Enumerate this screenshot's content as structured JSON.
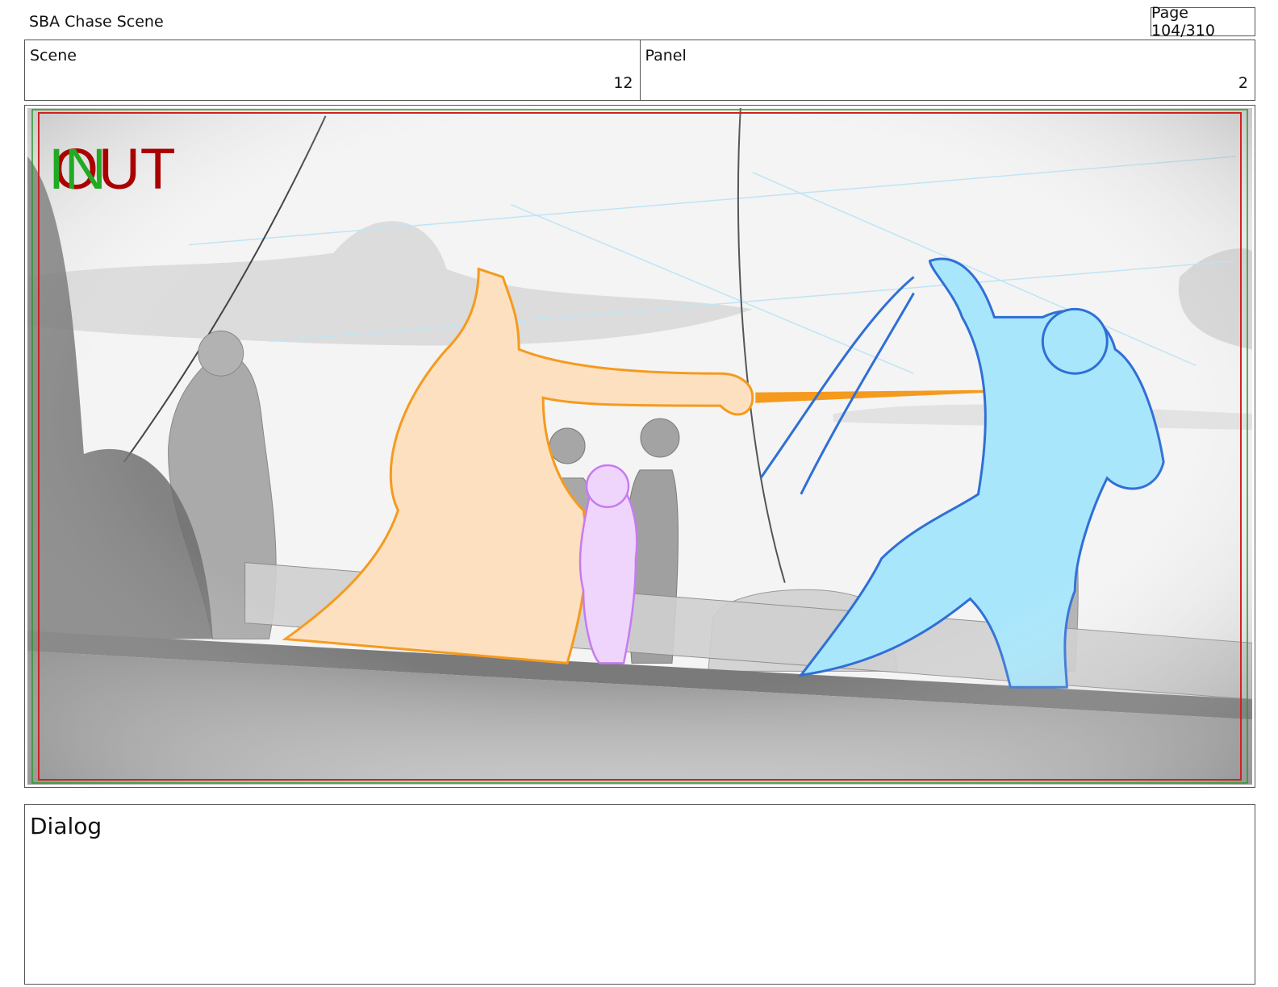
{
  "document": {
    "title": "SBA Chase Scene",
    "page": "Page 104/310"
  },
  "header": {
    "scene_label": "Scene",
    "scene_value": "12",
    "panel_label": "Panel",
    "panel_value": "2"
  },
  "panel": {
    "in_marker": "IN",
    "out_marker": "OUT",
    "colors": {
      "in_marker": "#22aa22",
      "out_marker": "#aa0000",
      "character_left": "#f59a1e",
      "character_right": "#3a86e8",
      "character_center": "#c57cf0"
    }
  },
  "dialog": {
    "label": "Dialog"
  }
}
